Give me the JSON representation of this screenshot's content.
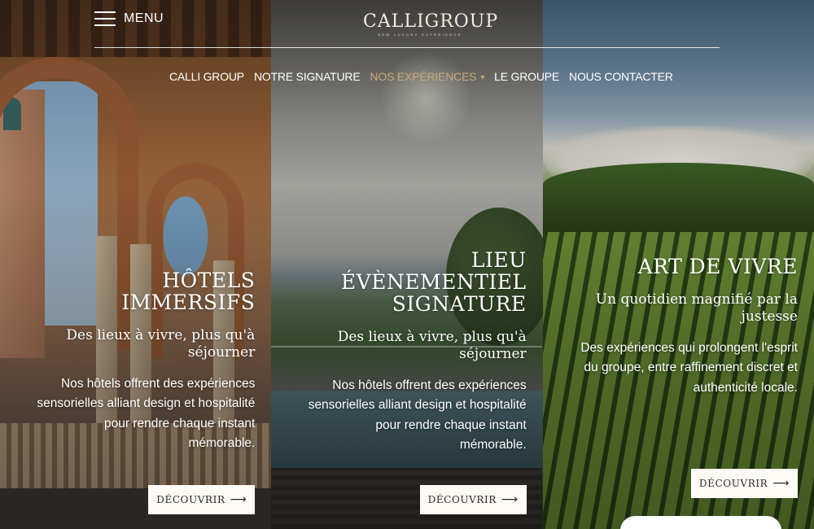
{
  "header": {
    "menu_label": "MENU",
    "logo_text": "CALLIGROUP",
    "logo_tagline": "NEW LUXURY EXPERIENCE",
    "nav": [
      {
        "label": "CALLI GROUP"
      },
      {
        "label": "NOTRE SIGNATURE"
      },
      {
        "label": "NOS EXPÉRIENCES",
        "active": true
      },
      {
        "label": "LE GROUPE"
      },
      {
        "label": "NOUS CONTACTER"
      }
    ]
  },
  "panels": [
    {
      "title": "HÔTELS IMMERSIFS",
      "subtitle": "Des lieux à vivre, plus qu'à séjourner",
      "description": "Nos hôtels offrent des expériences sensorielles alliant design et hospitalité pour rendre chaque instant mémorable.",
      "button": "DÉCOUVRIR"
    },
    {
      "title": "LIEU ÉVÈNEMENTIEL SIGNATURE",
      "subtitle": "Des lieux à vivre, plus qu'à séjourner",
      "description": "Nos hôtels offrent des expériences sensorielles alliant design et hospitalité pour rendre chaque instant mémorable.",
      "button": "DÉCOUVRIR"
    },
    {
      "title": "ART DE VIVRE",
      "subtitle": "Un quotidien magnifié par la justesse",
      "description": "Des expériences qui prolongent l'esprit du groupe, entre raffinement discret et authenticité locale.",
      "button": "DÉCOUVRIR"
    }
  ],
  "icons": {
    "menu": "hamburger-icon",
    "nav_dropdown": "chevron-down-icon",
    "button_arrow": "arrow-right-icon"
  },
  "colors": {
    "accent": "#c9a879",
    "button_bg": "#fdfbf6",
    "button_text": "#2d2a26"
  }
}
